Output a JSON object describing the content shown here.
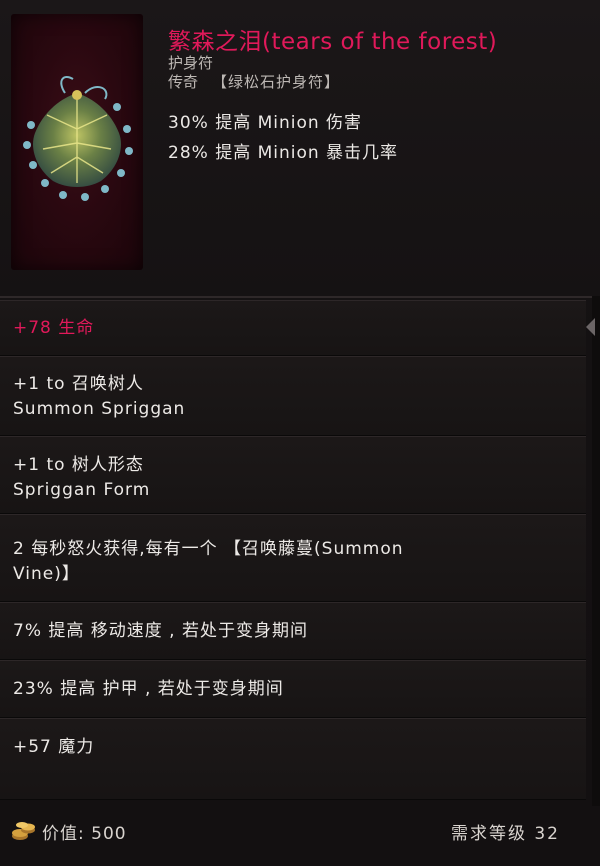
{
  "item": {
    "name": "繁森之泪(tears of the forest)",
    "type": "护身符",
    "rarity": "传奇",
    "base": "【绿松石护身符】",
    "implicits": [
      "30% 提高 Minion 伤害",
      "28% 提高 Minion 暴击几率"
    ]
  },
  "affixes": [
    {
      "lines": [
        "+78 生命"
      ],
      "highlight": true
    },
    {
      "lines": [
        "+1 to 召唤树人",
        "Summon Spriggan"
      ]
    },
    {
      "lines": [
        "+1 to 树人形态",
        "Spriggan Form"
      ]
    },
    {
      "lines": [
        "2 每秒怒火获得,每有一个 【召唤藤蔓(Summon",
        "Vine)】"
      ]
    },
    {
      "lines": [
        "7% 提高 移动速度 , 若处于变身期间"
      ]
    },
    {
      "lines": [
        "23% 提高 护甲 , 若处于变身期间"
      ]
    },
    {
      "lines": [
        "+57 魔力"
      ]
    }
  ],
  "footer": {
    "value_text": "价值: 500",
    "requirement_text": "需求等级 32"
  },
  "icons": {
    "portrait": "leaf-amulet-icon",
    "coin": "coin-stack-icon",
    "scroll": "arrow-left-icon"
  },
  "colors": {
    "legendary_name": "#e0195a",
    "portrait_bg": "#2a0810"
  }
}
